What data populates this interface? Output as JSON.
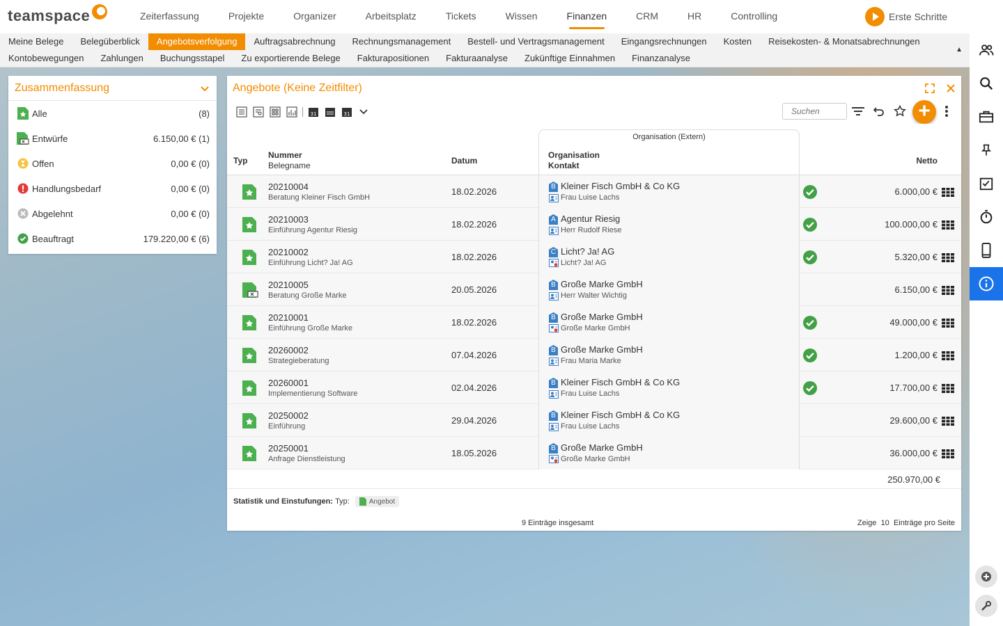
{
  "brand": {
    "name": "teamspace"
  },
  "topnav": [
    "Zeiterfassung",
    "Projekte",
    "Organizer",
    "Arbeitsplatz",
    "Tickets",
    "Wissen",
    "Finanzen",
    "CRM",
    "HR",
    "Controlling"
  ],
  "first_steps": "Erste Schritte",
  "subnav": {
    "row1": [
      "Meine Belege",
      "Belegüberblick",
      "Angebotsverfolgung",
      "Auftragsabrechnung",
      "Rechnungsmanagement",
      "Bestell- und Vertragsmanagement",
      "Eingangsrechnungen",
      "Kosten",
      "Reisekosten- & Monatsabrechnungen"
    ],
    "row2": [
      "Kontobewegungen",
      "Zahlungen",
      "Buchungsstapel",
      "Zu exportierende Belege",
      "Fakturapositionen",
      "Fakturaanalyse",
      "Zukünftige Einnahmen",
      "Finanzanalyse"
    ],
    "active": "Angebotsverfolgung"
  },
  "summary": {
    "title": "Zusammenfassung",
    "rows": [
      {
        "label": "Alle",
        "value": "(8)",
        "icon": "doc-star-icon"
      },
      {
        "label": "Entwürfe",
        "value": "6.150,00 € (1)",
        "icon": "doc-draft-icon"
      },
      {
        "label": "Offen",
        "value": "0,00 € (0)",
        "icon": "hourglass-icon"
      },
      {
        "label": "Handlungsbedarf",
        "value": "0,00 € (0)",
        "icon": "alert-icon"
      },
      {
        "label": "Abgelehnt",
        "value": "0,00 € (0)",
        "icon": "reject-icon"
      },
      {
        "label": "Beauftragt",
        "value": "179.220,00 € (6)",
        "icon": "check-icon"
      }
    ]
  },
  "panel": {
    "title": "Angebote (Keine Zeitfilter)",
    "search_placeholder": "Suchen",
    "columns": {
      "typ": "Typ",
      "nummer": "Nummer",
      "belegname": "Belegname",
      "datum": "Datum",
      "org_group": "Organisation (Extern)",
      "organisation": "Organisation",
      "kontakt": "Kontakt",
      "netto": "Netto"
    },
    "rows": [
      {
        "nummer": "20210004",
        "belegname": "Beratung Kleiner Fisch GmbH",
        "datum": "18.02.2026",
        "org": "Kleiner Fisch GmbH & Co KG",
        "org_letter": "B",
        "kontakt": "Frau Luise Lachs",
        "kontakt_type": "person",
        "status": "beauftragt",
        "netto": "6.000,00 €",
        "typ": "angebot"
      },
      {
        "nummer": "20210003",
        "belegname": "Einführung Agentur Riesig",
        "datum": "18.02.2026",
        "org": "Agentur Riesig",
        "org_letter": "A",
        "kontakt": "Herr Rudolf Riese",
        "kontakt_type": "person",
        "status": "beauftragt",
        "netto": "100.000,00 €",
        "typ": "angebot"
      },
      {
        "nummer": "20210002",
        "belegname": "Einführung Licht? Ja! AG",
        "datum": "18.02.2026",
        "org": "Licht? Ja! AG",
        "org_letter": "C",
        "kontakt": "Licht? Ja! AG",
        "kontakt_type": "location",
        "status": "beauftragt",
        "netto": "5.320,00 €",
        "typ": "angebot"
      },
      {
        "nummer": "20210005",
        "belegname": "Beratung Große Marke",
        "datum": "20.05.2026",
        "org": "Große Marke GmbH",
        "org_letter": "B",
        "kontakt": "Herr Walter Wichtig",
        "kontakt_type": "person",
        "status": "entwurf",
        "netto": "6.150,00 €",
        "typ": "entwurf"
      },
      {
        "nummer": "20210001",
        "belegname": "Einführung Große Marke",
        "datum": "18.02.2026",
        "org": "Große Marke GmbH",
        "org_letter": "B",
        "kontakt": "Große Marke GmbH",
        "kontakt_type": "location",
        "status": "beauftragt",
        "netto": "49.000,00 €",
        "typ": "angebot"
      },
      {
        "nummer": "20260002",
        "belegname": "Strategieberatung",
        "datum": "07.04.2026",
        "org": "Große Marke GmbH",
        "org_letter": "B",
        "kontakt": "Frau Maria Marke",
        "kontakt_type": "person",
        "status": "beauftragt",
        "netto": "1.200,00 €",
        "typ": "angebot"
      },
      {
        "nummer": "20260001",
        "belegname": "Implementierung Software",
        "datum": "02.04.2026",
        "org": "Kleiner Fisch GmbH & Co KG",
        "org_letter": "B",
        "kontakt": "Frau Luise Lachs",
        "kontakt_type": "person",
        "status": "beauftragt",
        "netto": "17.700,00 €",
        "typ": "angebot"
      },
      {
        "nummer": "20250002",
        "belegname": "Einführung",
        "datum": "29.04.2026",
        "org": "Kleiner Fisch GmbH & Co KG",
        "org_letter": "B",
        "kontakt": "Frau Luise Lachs",
        "kontakt_type": "person",
        "status": "offen",
        "netto": "29.600,00 €",
        "typ": "angebot"
      },
      {
        "nummer": "20250001",
        "belegname": "Anfrage Dienstleistung",
        "datum": "18.05.2026",
        "org": "Große Marke GmbH",
        "org_letter": "B",
        "kontakt": "Große Marke GmbH",
        "kontakt_type": "location",
        "status": "offen",
        "netto": "36.000,00 €",
        "typ": "angebot"
      }
    ],
    "total": "250.970,00 €",
    "stat_label": "Statistik und Einstufungen:",
    "stat_typ": "Typ:",
    "stat_badge": "Angebot",
    "entries_total": "9 Einträge insgesamt",
    "per_page_prefix": "Zeige",
    "per_page": "10",
    "per_page_suffix": "Einträge pro Seite"
  },
  "colors": {
    "accent": "#f28c00",
    "sidebar_active": "#1a73e8",
    "doc_green": "#4caf50",
    "check_green": "#43a047",
    "org_blue": "#3b7fc4"
  }
}
